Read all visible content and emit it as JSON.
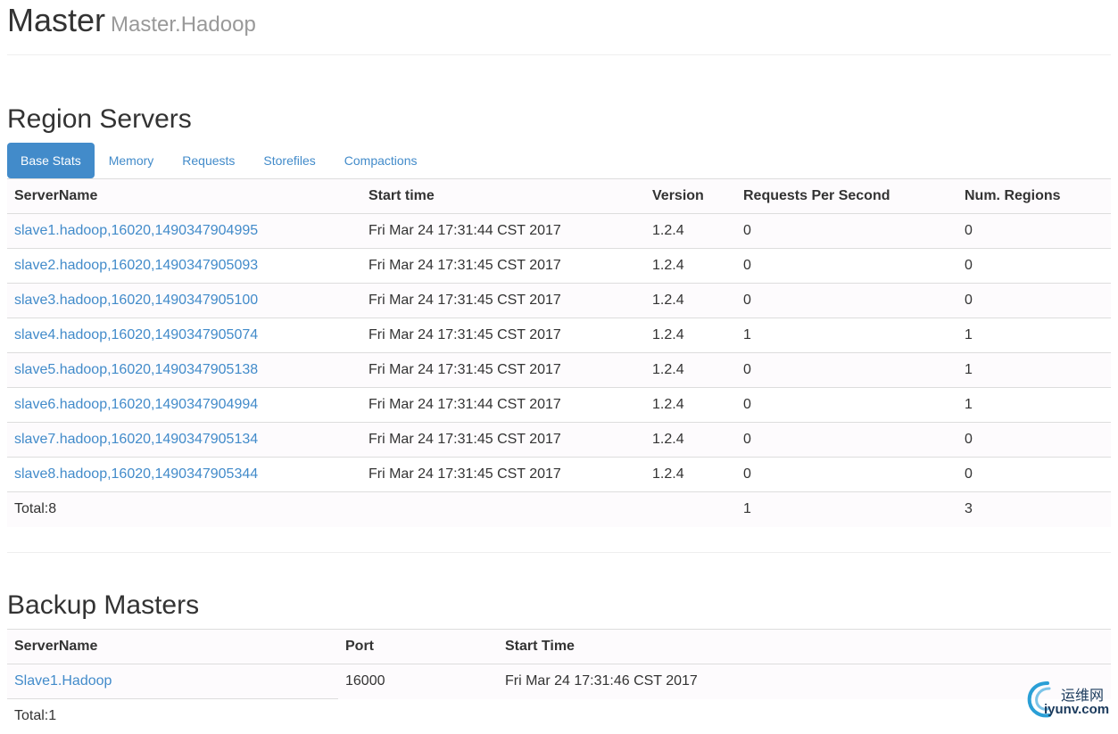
{
  "header": {
    "title": "Master",
    "subtitle": "Master.Hadoop"
  },
  "region_servers": {
    "title": "Region Servers",
    "tabs": [
      {
        "label": "Base Stats",
        "active": true
      },
      {
        "label": "Memory",
        "active": false
      },
      {
        "label": "Requests",
        "active": false
      },
      {
        "label": "Storefiles",
        "active": false
      },
      {
        "label": "Compactions",
        "active": false
      }
    ],
    "columns": [
      "ServerName",
      "Start time",
      "Version",
      "Requests Per Second",
      "Num. Regions"
    ],
    "rows": [
      {
        "server": "slave1.hadoop,16020,1490347904995",
        "start": "Fri Mar 24 17:31:44 CST 2017",
        "version": "1.2.4",
        "rps": "0",
        "regions": "0"
      },
      {
        "server": "slave2.hadoop,16020,1490347905093",
        "start": "Fri Mar 24 17:31:45 CST 2017",
        "version": "1.2.4",
        "rps": "0",
        "regions": "0"
      },
      {
        "server": "slave3.hadoop,16020,1490347905100",
        "start": "Fri Mar 24 17:31:45 CST 2017",
        "version": "1.2.4",
        "rps": "0",
        "regions": "0"
      },
      {
        "server": "slave4.hadoop,16020,1490347905074",
        "start": "Fri Mar 24 17:31:45 CST 2017",
        "version": "1.2.4",
        "rps": "1",
        "regions": "1"
      },
      {
        "server": "slave5.hadoop,16020,1490347905138",
        "start": "Fri Mar 24 17:31:45 CST 2017",
        "version": "1.2.4",
        "rps": "0",
        "regions": "1"
      },
      {
        "server": "slave6.hadoop,16020,1490347904994",
        "start": "Fri Mar 24 17:31:44 CST 2017",
        "version": "1.2.4",
        "rps": "0",
        "regions": "1"
      },
      {
        "server": "slave7.hadoop,16020,1490347905134",
        "start": "Fri Mar 24 17:31:45 CST 2017",
        "version": "1.2.4",
        "rps": "0",
        "regions": "0"
      },
      {
        "server": "slave8.hadoop,16020,1490347905344",
        "start": "Fri Mar 24 17:31:45 CST 2017",
        "version": "1.2.4",
        "rps": "0",
        "regions": "0"
      }
    ],
    "total": {
      "label": "Total:8",
      "rps": "1",
      "regions": "3"
    }
  },
  "backup_masters": {
    "title": "Backup Masters",
    "columns": [
      "ServerName",
      "Port",
      "Start Time"
    ],
    "rows": [
      {
        "server": "Slave1.Hadoop",
        "port": "16000",
        "start": "Fri Mar 24 17:31:46 CST 2017"
      }
    ],
    "total": {
      "label": "Total:1"
    }
  },
  "watermark": {
    "cn": "运维网",
    "en": "iyunv.com"
  },
  "colors": {
    "accent": "#428bca",
    "text": "#333333",
    "muted": "#999999",
    "border": "#dddddd"
  }
}
